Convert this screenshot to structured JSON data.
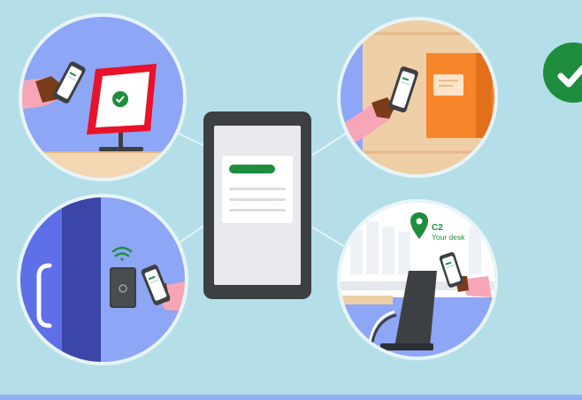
{
  "colors": {
    "background": "#b4dfe8",
    "accent_green": "#1e8e3e",
    "accent_orange": "#f8862a",
    "accent_red": "#e8122a",
    "accent_blue": "#8ea6f6",
    "phone_frame": "#3c4043",
    "bottom_bar": "#8fb2f5"
  },
  "icons": [
    "phone-icon",
    "checkmark-icon",
    "wifi-icon",
    "location-pin-icon",
    "chair-icon"
  ],
  "desk_tag": {
    "code": "C2",
    "label": "Your desk"
  }
}
